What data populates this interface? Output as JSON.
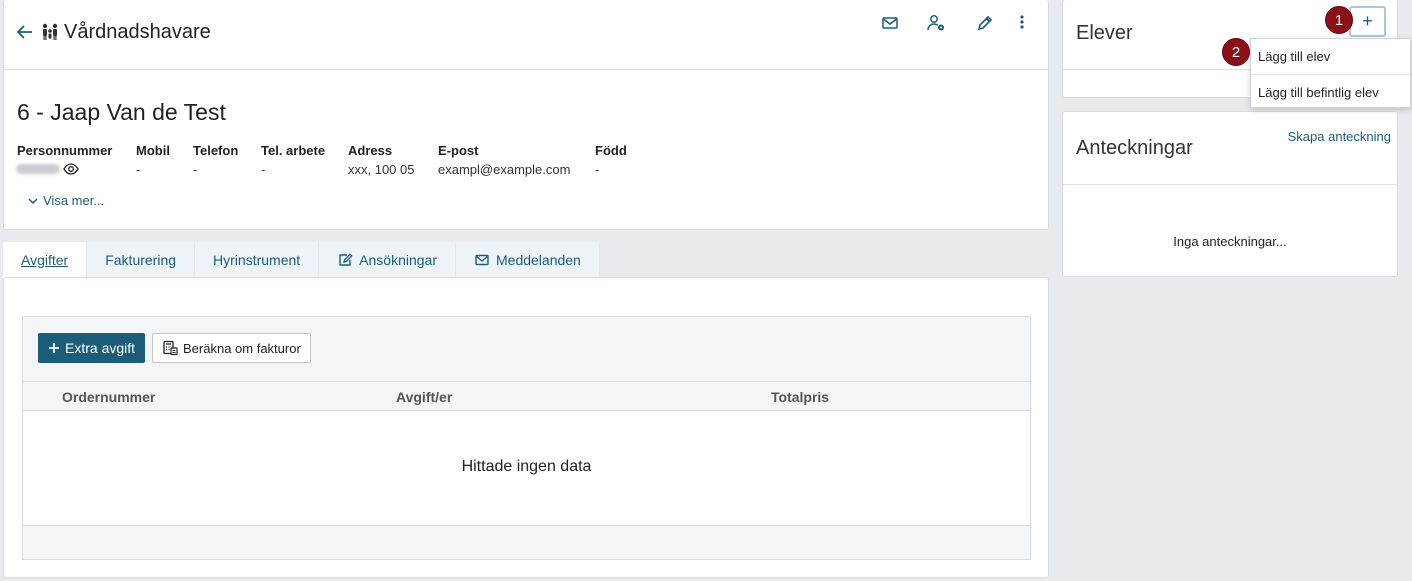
{
  "header": {
    "title": "Vårdnadshavare",
    "name": "6 - Jaap Van de Test",
    "fields": [
      {
        "label": "Personnummer",
        "value": ""
      },
      {
        "label": "Mobil",
        "value": "-"
      },
      {
        "label": "Telefon",
        "value": "-"
      },
      {
        "label": "Tel. arbete",
        "value": "-"
      },
      {
        "label": "Adress",
        "value": "xxx, 100 05"
      },
      {
        "label": "E-post",
        "value": "exampl@example.com"
      },
      {
        "label": "Född",
        "value": "-"
      }
    ],
    "show_more": "Visa mer..."
  },
  "tabs": [
    {
      "label": "Avgifter",
      "active": true
    },
    {
      "label": "Fakturering"
    },
    {
      "label": "Hyrinstrument"
    },
    {
      "label": "Ansökningar",
      "icon": "edit-document-icon"
    },
    {
      "label": "Meddelanden",
      "icon": "envelope-icon"
    }
  ],
  "fees": {
    "add_button": "Extra avgift",
    "recalc_button": "Beräkna om fakturor",
    "columns": [
      "Ordernummer",
      "Avgift/er",
      "Totalpris"
    ],
    "empty_text": "Hittade ingen data"
  },
  "elever": {
    "title": "Elever",
    "plus": "+",
    "menu": [
      "Lägg till elev",
      "Lägg till befintlig elev"
    ]
  },
  "notes": {
    "title": "Anteckningar",
    "create_link": "Skapa anteckning",
    "empty_text": "Inga anteckningar..."
  },
  "markers": [
    "1",
    "2"
  ],
  "colors": {
    "accent": "#1c5d7a",
    "marker": "#8b1018"
  }
}
